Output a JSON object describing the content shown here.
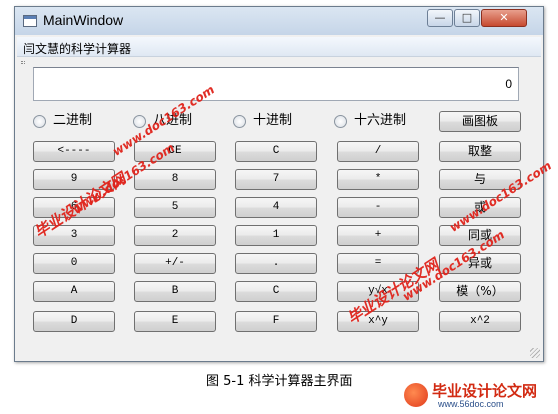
{
  "window": {
    "title": "MainWindow",
    "controls": {
      "minimize": "—",
      "maximize": "□",
      "close": "✕"
    }
  },
  "menu": {
    "item": "闫文慧的科学计算器"
  },
  "display": {
    "value": "0"
  },
  "radios": [
    {
      "label": "二进制"
    },
    {
      "label": "八进制"
    },
    {
      "label": "十进制"
    },
    {
      "label": "十六进制"
    }
  ],
  "buttons": {
    "draw": "画图板",
    "backspace": "<----",
    "ce": "CE",
    "clear": "C",
    "divide": "/",
    "round": "取整",
    "nine": "9",
    "eight": "8",
    "seven": "7",
    "multiply": "*",
    "and": "与",
    "six": "6",
    "five": "5",
    "four": "4",
    "minus": "-",
    "or": "或",
    "three": "3",
    "two": "2",
    "one": "1",
    "plus": "+",
    "xnor": "同或",
    "zero": "0",
    "sign": "+/-",
    "dot": ".",
    "equals": "=",
    "xor": "异或",
    "hex_a": "A",
    "hex_b": "B",
    "hex_c": "C",
    "root": "y√x",
    "mod": "模（%）",
    "hex_d": "D",
    "hex_e": "E",
    "hex_f": "F",
    "power": "x^y",
    "square": "x^2"
  },
  "caption": "图 5-1   科学计算器主界面",
  "watermark": {
    "site_cn": "毕业设计论文网",
    "site_url": "www.doc163.com",
    "logo_url": "www.56doc.com"
  },
  "colors": {
    "watermark": "#e0231b",
    "title_gradient_top": "#dbe6f2",
    "close_button": "#c74a2f"
  }
}
